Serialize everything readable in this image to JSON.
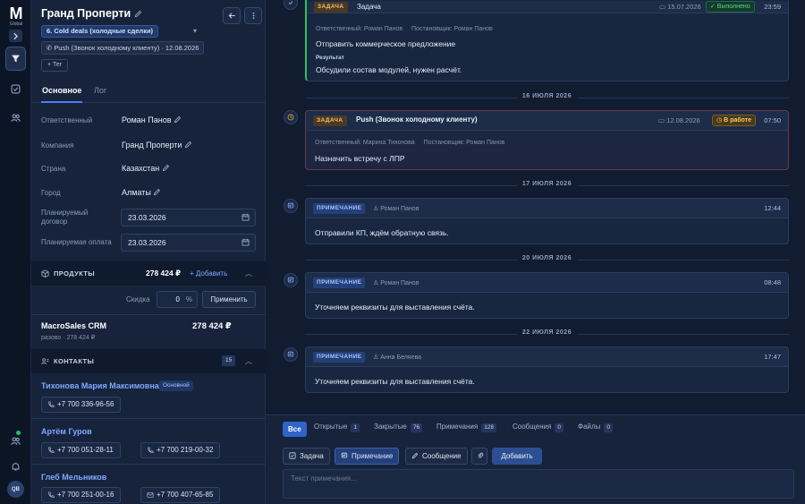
{
  "rail": {
    "logo_letter": "M",
    "logo_sub": "Global",
    "avatar": "QB"
  },
  "deal": {
    "title": "Гранд Проперти",
    "stage": "6. Cold deals (холодные сделки)",
    "push_chip": "Push (Звонок холодному клиенту) · 12.08.2026",
    "tag_button": "+ Тег",
    "tabs": {
      "main": "Основное",
      "log": "Лог"
    },
    "fields": {
      "owner_label": "Ответственный",
      "owner": "Роман Панов",
      "company_label": "Компания",
      "company": "Гранд Проперти",
      "country_label": "Страна",
      "country": "Казахстан",
      "city_label": "Город",
      "city": "Алматы",
      "planned_contract_label_1": "Планируемый",
      "planned_contract_label_2": "договор",
      "planned_contract": "23.03.2026",
      "planned_payment_label": "Планируемая оплата",
      "planned_payment": "23.03.2026"
    },
    "products": {
      "title": "ПРОДУКТЫ",
      "total": "278 424 ₽",
      "add": "+ Добавить",
      "discount_label": "Скидка",
      "discount_value": "0",
      "discount_unit": "%",
      "apply": "Применить",
      "item_name": "MacroSales CRM",
      "item_price": "278 424 ₽",
      "item_sub": "разово · 278 424 ₽"
    },
    "contacts": {
      "title": "КОНТАКТЫ",
      "count": "15",
      "items": [
        {
          "name": "Тихонова Мария Максимовна",
          "badge": "Основной",
          "phones": [
            "+7 700 336-96-56"
          ]
        },
        {
          "name": "Артём Гуров",
          "phones": [
            "+7 700 051-28-11",
            "+7 700 219-00-32"
          ]
        },
        {
          "name": "Глеб Мельников",
          "phones": [
            "+7 700 251-00-16",
            "+7 700 407-65-85"
          ]
        }
      ]
    }
  },
  "timeline": {
    "card1": {
      "type": "ЗАДАЧА",
      "title": "Задача",
      "due": "15.07.2026",
      "status": "✓ Выполнено",
      "time": "23:59",
      "owner": "Ответственный: Роман Панов",
      "creator": "Постановщик: Роман Панов",
      "body": "Отправить коммерческое предложение",
      "result_label": "Результат",
      "result": "Обсудили состав модулей, нужен расчёт."
    },
    "sep1": "16 ИЮЛЯ 2026",
    "card2": {
      "type": "ЗАДАЧА",
      "title": "Push (Звонок холодному клиенту)",
      "due": "12.08.2026",
      "status": "В работе",
      "time": "07:50",
      "owner": "Ответственный: Марина Тихонова",
      "creator": "Постановщик: Роман Панов",
      "body": "Назначить встречу с ЛПР"
    },
    "sep2": "17 ИЮЛЯ 2026",
    "card3": {
      "type": "ПРИМЕЧАНИЕ",
      "author": "Роман Панов",
      "time": "12:44",
      "body": "Отправили КП, ждём обратную связь."
    },
    "sep3": "20 ИЮЛЯ 2026",
    "card4": {
      "type": "ПРИМЕЧАНИЕ",
      "author": "Роман Панов",
      "time": "08:48",
      "body": "Уточняем реквизиты для выставления счёта."
    },
    "sep4": "22 ИЮЛЯ 2026",
    "card5": {
      "type": "ПРИМЕЧАНИЕ",
      "author": "Анна Беляева",
      "time": "17:47",
      "body": "Уточняем реквизиты для выставления счёта."
    }
  },
  "composer": {
    "filters": [
      {
        "label": "Все"
      },
      {
        "label": "Открытые",
        "count": "1"
      },
      {
        "label": "Закрытые",
        "count": "76"
      },
      {
        "label": "Примечания",
        "count": "128"
      },
      {
        "label": "Сообщения",
        "count": "0"
      },
      {
        "label": "Файлы",
        "count": "0"
      }
    ],
    "task_btn": "Задача",
    "note_btn": "Примечание",
    "message_btn": "Сообщение",
    "add_btn": "Добавить",
    "placeholder": "Текст примечания..."
  },
  "colors": {
    "accent": "#3163c9",
    "success": "#4ade80",
    "warning": "#f7c869",
    "link": "#7fa9ff"
  }
}
